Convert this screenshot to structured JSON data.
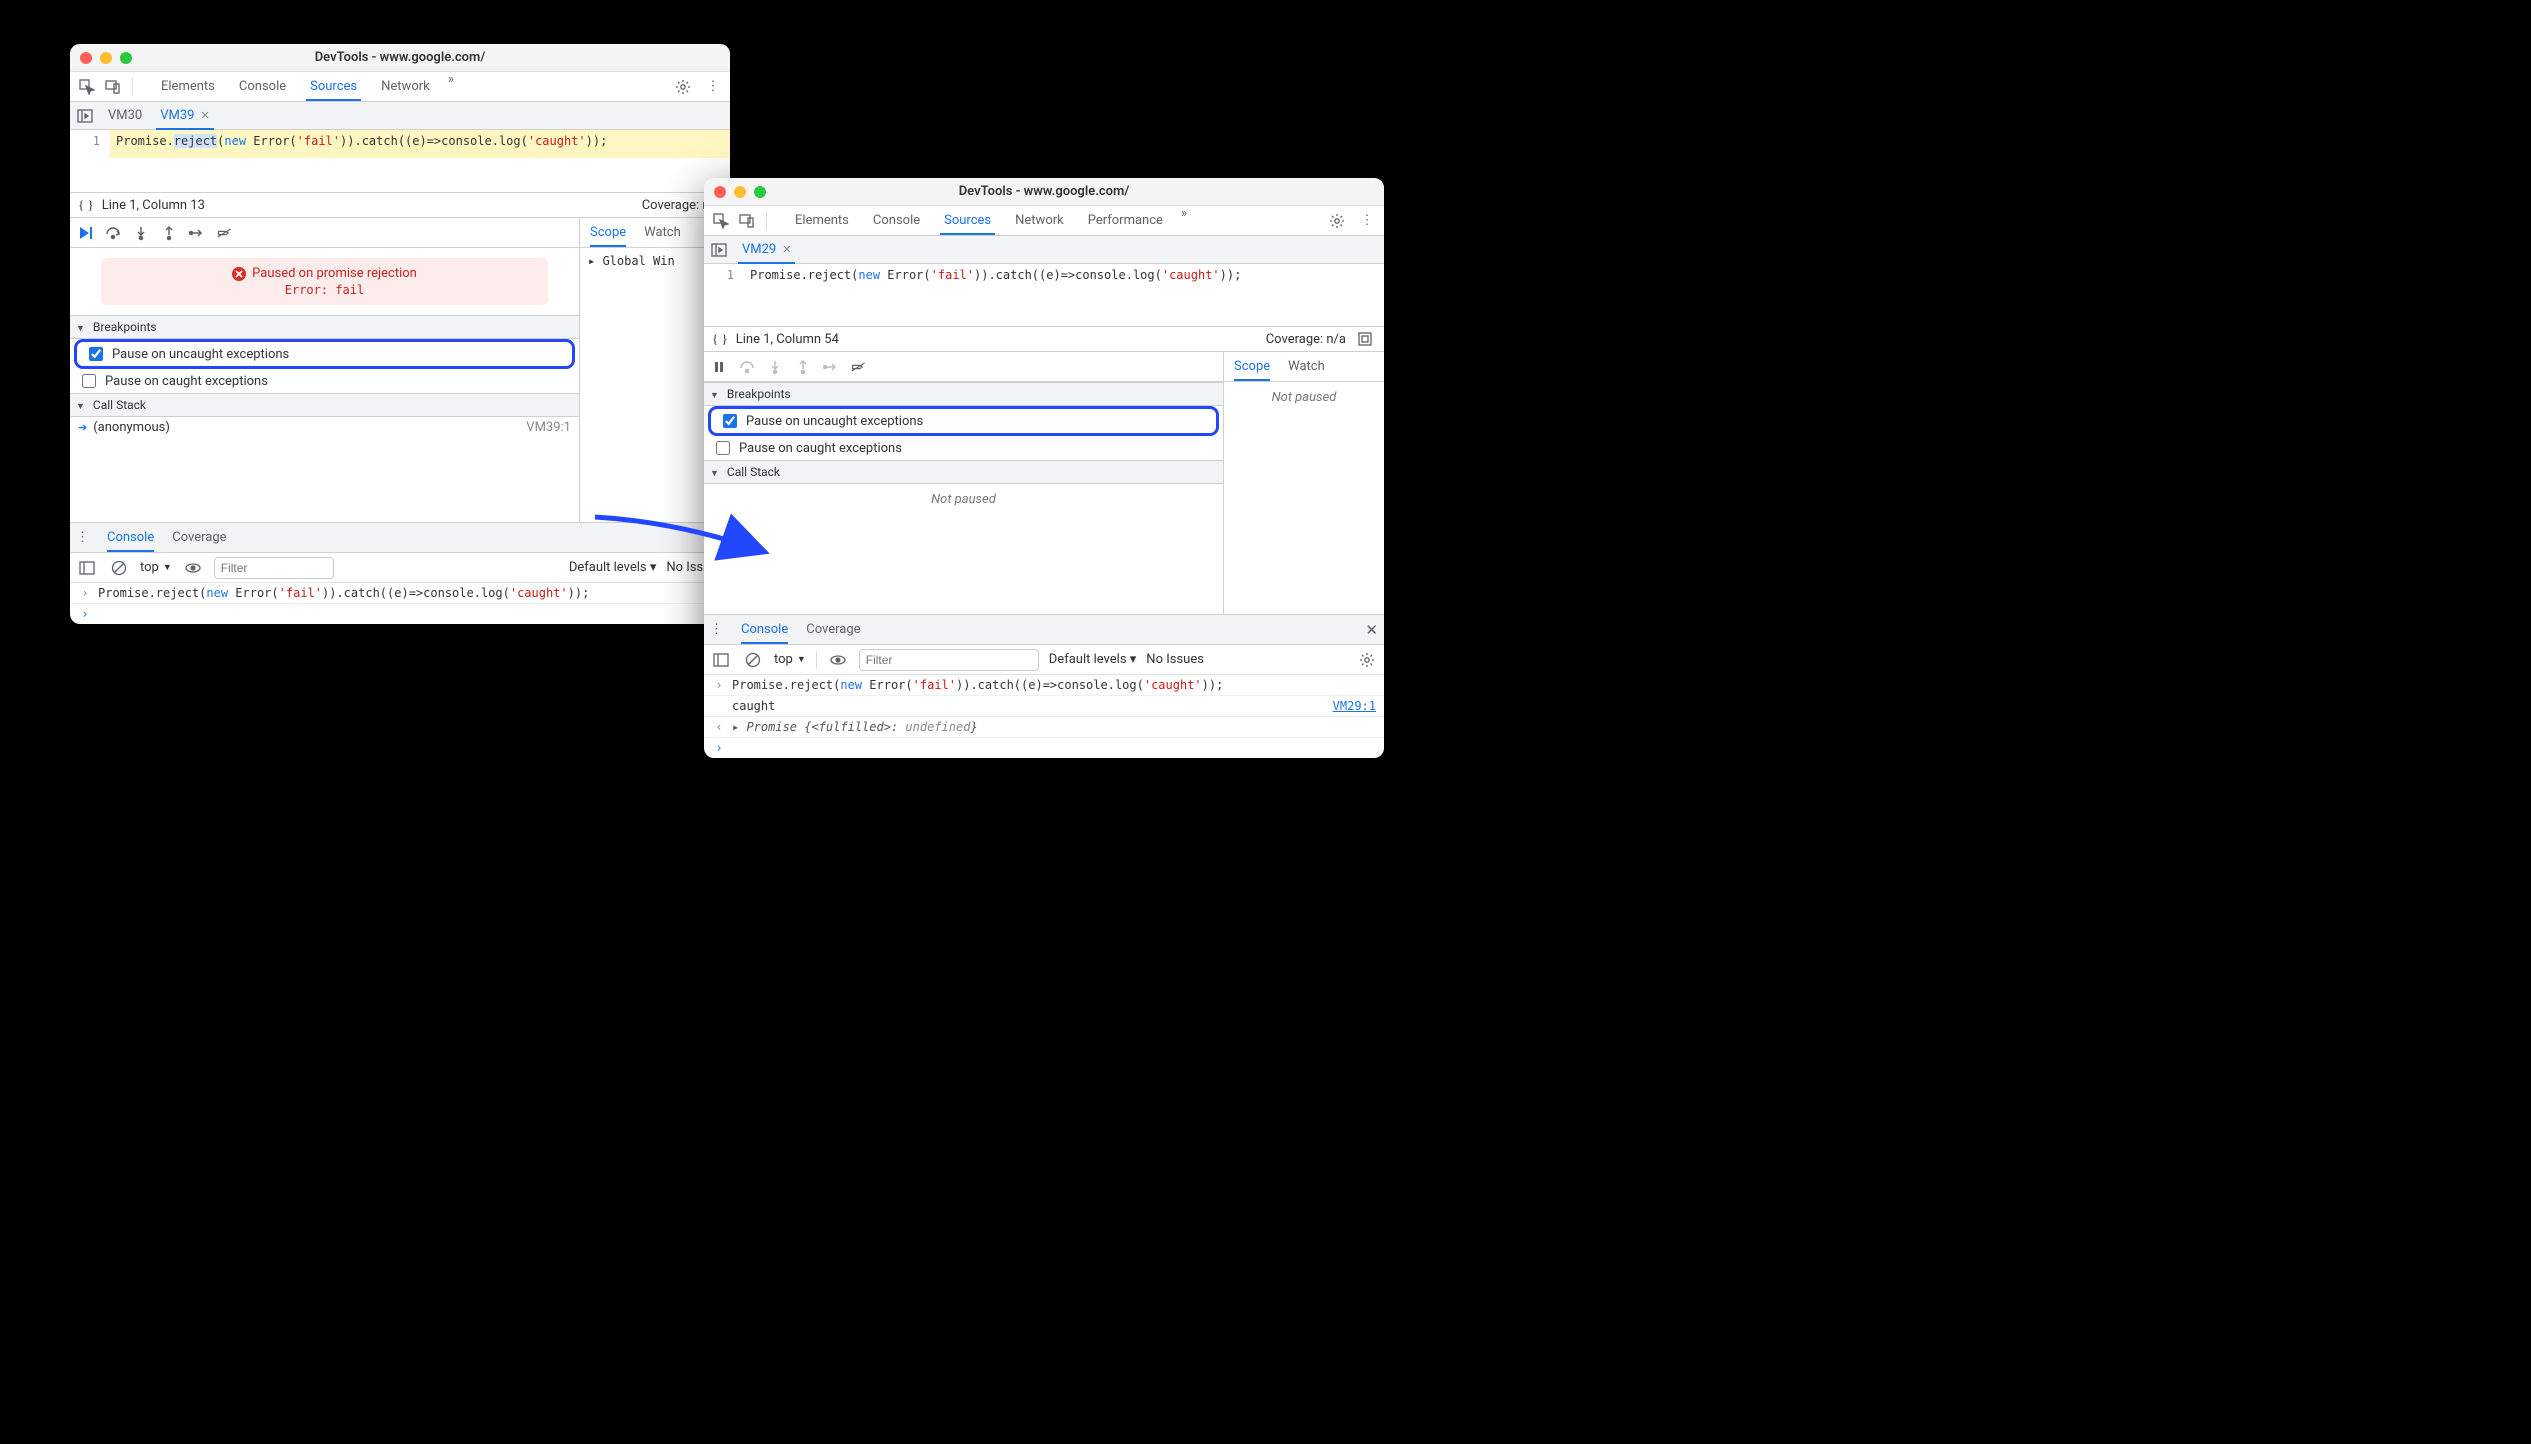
{
  "win1": {
    "title": "DevTools - www.google.com/",
    "tabs": [
      "Elements",
      "Console",
      "Sources",
      "Network"
    ],
    "activeTab": "Sources",
    "fileTabs": {
      "files": [
        "VM30",
        "VM39"
      ],
      "active": "VM39"
    },
    "code": {
      "lineno": "1",
      "pre": "Promise.",
      "sel": "reject",
      "post1": "(",
      "kw_new": "new",
      "post2": " Error(",
      "str1": "'fail'",
      "post3": ")).catch((e)=>console.log(",
      "str2": "'caught'",
      "post4": "));"
    },
    "status": {
      "pos": "Line 1, Column 13",
      "cov": "Coverage: n/a"
    },
    "paused": {
      "title": "Paused on promise rejection",
      "err": "Error: fail"
    },
    "breakpoints": {
      "header": "Breakpoints",
      "uncaught": "Pause on uncaught exceptions",
      "caught": "Pause on caught exceptions"
    },
    "callstack": {
      "header": "Call Stack",
      "frame": "(anonymous)",
      "loc": "VM39:1"
    },
    "scope": {
      "tab1": "Scope",
      "tab2": "Watch",
      "row": "▸ Global    Win"
    },
    "drawer": {
      "console": "Console",
      "coverage": "Coverage"
    },
    "consoleTb": {
      "ctx": "top",
      "filter_ph": "Filter",
      "levels": "Default levels ▾",
      "issues": "No Issues"
    },
    "consoleLines": {
      "l1_pre": "Promise.reject(",
      "l1_kw": "new",
      "l1_mid": " Error(",
      "l1_s1": "'fail'",
      "l1_mid2": ")).catch((e)=>console.log(",
      "l1_s2": "'caught'",
      "l1_end": "));"
    }
  },
  "win2": {
    "title": "DevTools - www.google.com/",
    "tabs": [
      "Elements",
      "Console",
      "Sources",
      "Network",
      "Performance"
    ],
    "activeTab": "Sources",
    "fileTabs": {
      "active": "VM29"
    },
    "code": {
      "lineno": "1",
      "pre": "Promise.reject(",
      "kw_new": "new",
      "post1": " Error(",
      "str1": "'fail'",
      "post2": ")).catch((e)=>console.log(",
      "str2": "'caught'",
      "post3": "));"
    },
    "status": {
      "pos": "Line 1, Column 54",
      "cov": "Coverage: n/a"
    },
    "breakpoints": {
      "header": "Breakpoints",
      "uncaught": "Pause on uncaught exceptions",
      "caught": "Pause on caught exceptions"
    },
    "callstack": {
      "header": "Call Stack",
      "np": "Not paused"
    },
    "scope": {
      "tab1": "Scope",
      "tab2": "Watch",
      "np": "Not paused"
    },
    "drawer": {
      "console": "Console",
      "coverage": "Coverage"
    },
    "consoleTb": {
      "ctx": "top",
      "filter_ph": "Filter",
      "levels": "Default levels ▾",
      "issues": "No Issues"
    },
    "consoleLines": {
      "l1_pre": "Promise.reject(",
      "l1_kw": "new",
      "l1_mid": " Error(",
      "l1_s1": "'fail'",
      "l1_mid2": ")).catch((e)=>console.log(",
      "l1_s2": "'caught'",
      "l1_end": "));",
      "caught": "caught",
      "link": "VM29:1",
      "promise_pre": "▸ Promise {",
      "promise_state": "<fulfilled>: ",
      "promise_val": "undefined",
      "promise_post": "}"
    }
  }
}
